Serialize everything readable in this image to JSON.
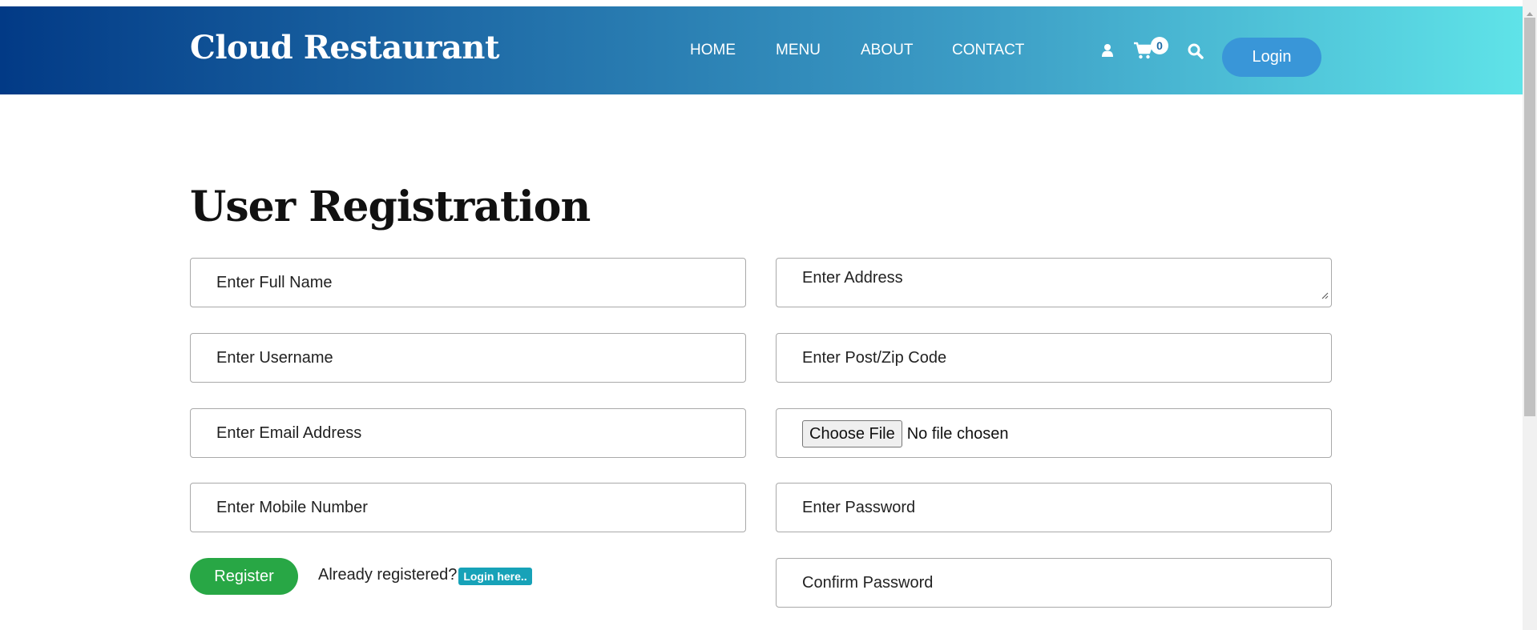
{
  "header": {
    "brand": "Cloud Restaurant",
    "nav": [
      "HOME",
      "MENU",
      "ABOUT",
      "CONTACT"
    ],
    "cart_count": "0",
    "login_label": "Login",
    "icons": [
      "user-icon",
      "cart-icon",
      "search-icon"
    ]
  },
  "page": {
    "title": "User Registration"
  },
  "form": {
    "full_name_placeholder": "Enter Full Name",
    "username_placeholder": "Enter Username",
    "email_placeholder": "Enter Email Address",
    "mobile_placeholder": "Enter Mobile Number",
    "address_placeholder": "Enter Address",
    "zip_placeholder": "Enter Post/Zip Code",
    "file_button_label": "Choose File",
    "file_status": "No file chosen",
    "password_placeholder": "Enter Password",
    "confirm_password_placeholder": "Confirm Password",
    "register_label": "Register",
    "already_registered_text": "Already registered?",
    "login_here_label": "Login here.."
  },
  "colors": {
    "header_gradient_start": "#023a86",
    "header_gradient_end": "#5fe3e8",
    "login_button": "#3996d8",
    "register_button": "#28a745",
    "login_here_badge": "#17a2b8"
  }
}
